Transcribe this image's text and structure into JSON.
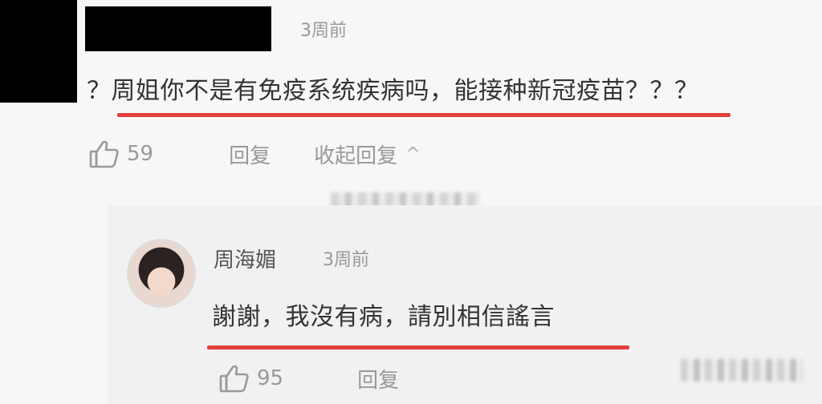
{
  "thread": {
    "comment": {
      "time": "3周前",
      "text": "？周姐你不是有免疫系统疾病吗，能接种新冠疫苗？？？",
      "likes": "59",
      "reply_label": "回复",
      "collapse_label": "收起回复"
    },
    "reply": {
      "author": "周海媚",
      "time": "3周前",
      "text": "謝謝，我沒有病，請別相信謠言",
      "likes": "95",
      "reply_label": "回复"
    }
  },
  "colors": {
    "underline": "#e0403a",
    "muted_text": "#999999",
    "body_text": "#333333"
  },
  "icons": {
    "like": "thumbs-up-icon",
    "collapse": "chevron-up-icon"
  }
}
